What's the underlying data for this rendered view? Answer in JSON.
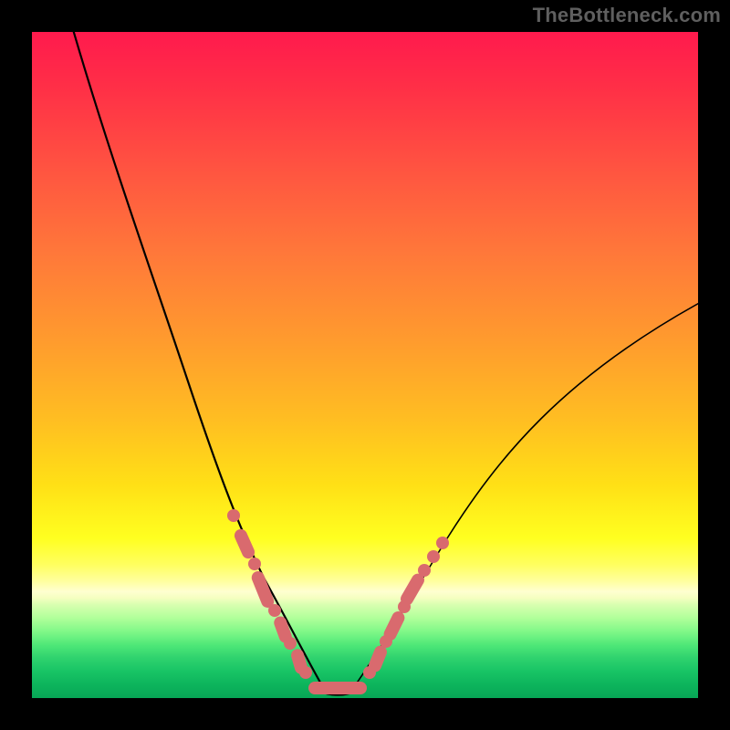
{
  "attribution": "TheBottleneck.com",
  "colors": {
    "dot": "#d96a6e",
    "curve": "#000000",
    "frame": "#000000"
  },
  "chart_data": {
    "type": "line",
    "title": "",
    "xlabel": "",
    "ylabel": "",
    "xlim": [
      0,
      100
    ],
    "ylim": [
      0,
      100
    ],
    "grid": false,
    "legend": false,
    "series": [
      {
        "name": "bottleneck-curve",
        "x": [
          5,
          10,
          15,
          20,
          24,
          28,
          31,
          34,
          36,
          38,
          40,
          42,
          44,
          50,
          56,
          62,
          68,
          74,
          80,
          86,
          92,
          98
        ],
        "y": [
          100,
          86,
          72,
          58,
          46,
          34,
          25,
          17,
          11,
          6,
          3,
          1,
          0,
          0,
          5,
          12,
          20,
          28,
          36,
          44,
          51,
          58
        ]
      }
    ],
    "markers": {
      "name": "highlight-dots",
      "x": [
        30,
        31,
        32,
        32.5,
        33,
        33.5,
        34,
        34.5,
        35,
        35.5,
        36,
        37,
        38,
        39,
        40,
        41,
        42,
        43,
        44,
        45,
        46,
        47,
        48,
        49,
        50,
        51,
        52,
        52.5,
        53,
        53.5,
        54,
        54.5,
        55,
        55.5,
        56,
        57,
        58
      ],
      "y": [
        28,
        25,
        22,
        20.5,
        19,
        17.5,
        16,
        14.5,
        13,
        11.5,
        10,
        8,
        6,
        4.5,
        3,
        2,
        1.2,
        0.7,
        0.3,
        0.1,
        0.1,
        0.4,
        0.9,
        1.6,
        2.5,
        3.6,
        4.8,
        5.5,
        6.3,
        7.1,
        8,
        8.9,
        9.9,
        10.9,
        12,
        14.2,
        16.5
      ]
    }
  }
}
